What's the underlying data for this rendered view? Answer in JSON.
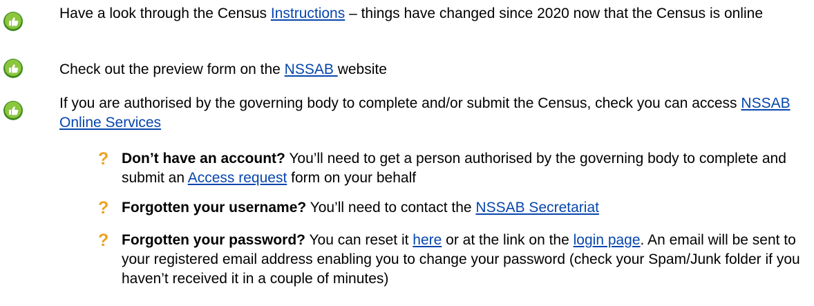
{
  "bullets": [
    {
      "before": "Have a look through the Census ",
      "link": "Instructions",
      "after": " – things have changed since 2020 now that the Census is online"
    },
    {
      "before": "Check out the preview form on the ",
      "link": "NSSAB ",
      "after": "website"
    },
    {
      "before": "If you are authorised by the governing body to complete and/or submit the Census, check you can access ",
      "link": "NSSAB Online Services",
      "after": ""
    }
  ],
  "questions": [
    {
      "mark": "?",
      "bold": "Don’t have an account?",
      "before": " You’ll need to get a person authorised by the governing body to complete and submit an ",
      "link": "Access request",
      "after": " form on your behalf"
    },
    {
      "mark": "?",
      "bold": "Forgotten your username?",
      "before": " You’ll need to contact the ",
      "link": "NSSAB Secretariat",
      "after": ""
    },
    {
      "mark": "?",
      "bold": "Forgotten your password?",
      "before": " You can reset it ",
      "link": "here",
      "middle": " or at the link on the ",
      "link2": "login page",
      "after": ". An email will be sent to your registered email address enabling you to change your password (check your Spam/Junk folder if you haven’t received it in a couple of minutes)"
    }
  ],
  "colors": {
    "icon_green": "#8cc63f",
    "icon_dark": "#3f8a1e",
    "question_orange": "#f0a020",
    "link_blue": "#0645ad"
  },
  "icons": {
    "bullet": "thumbs-up-icon",
    "question": "question-mark"
  }
}
